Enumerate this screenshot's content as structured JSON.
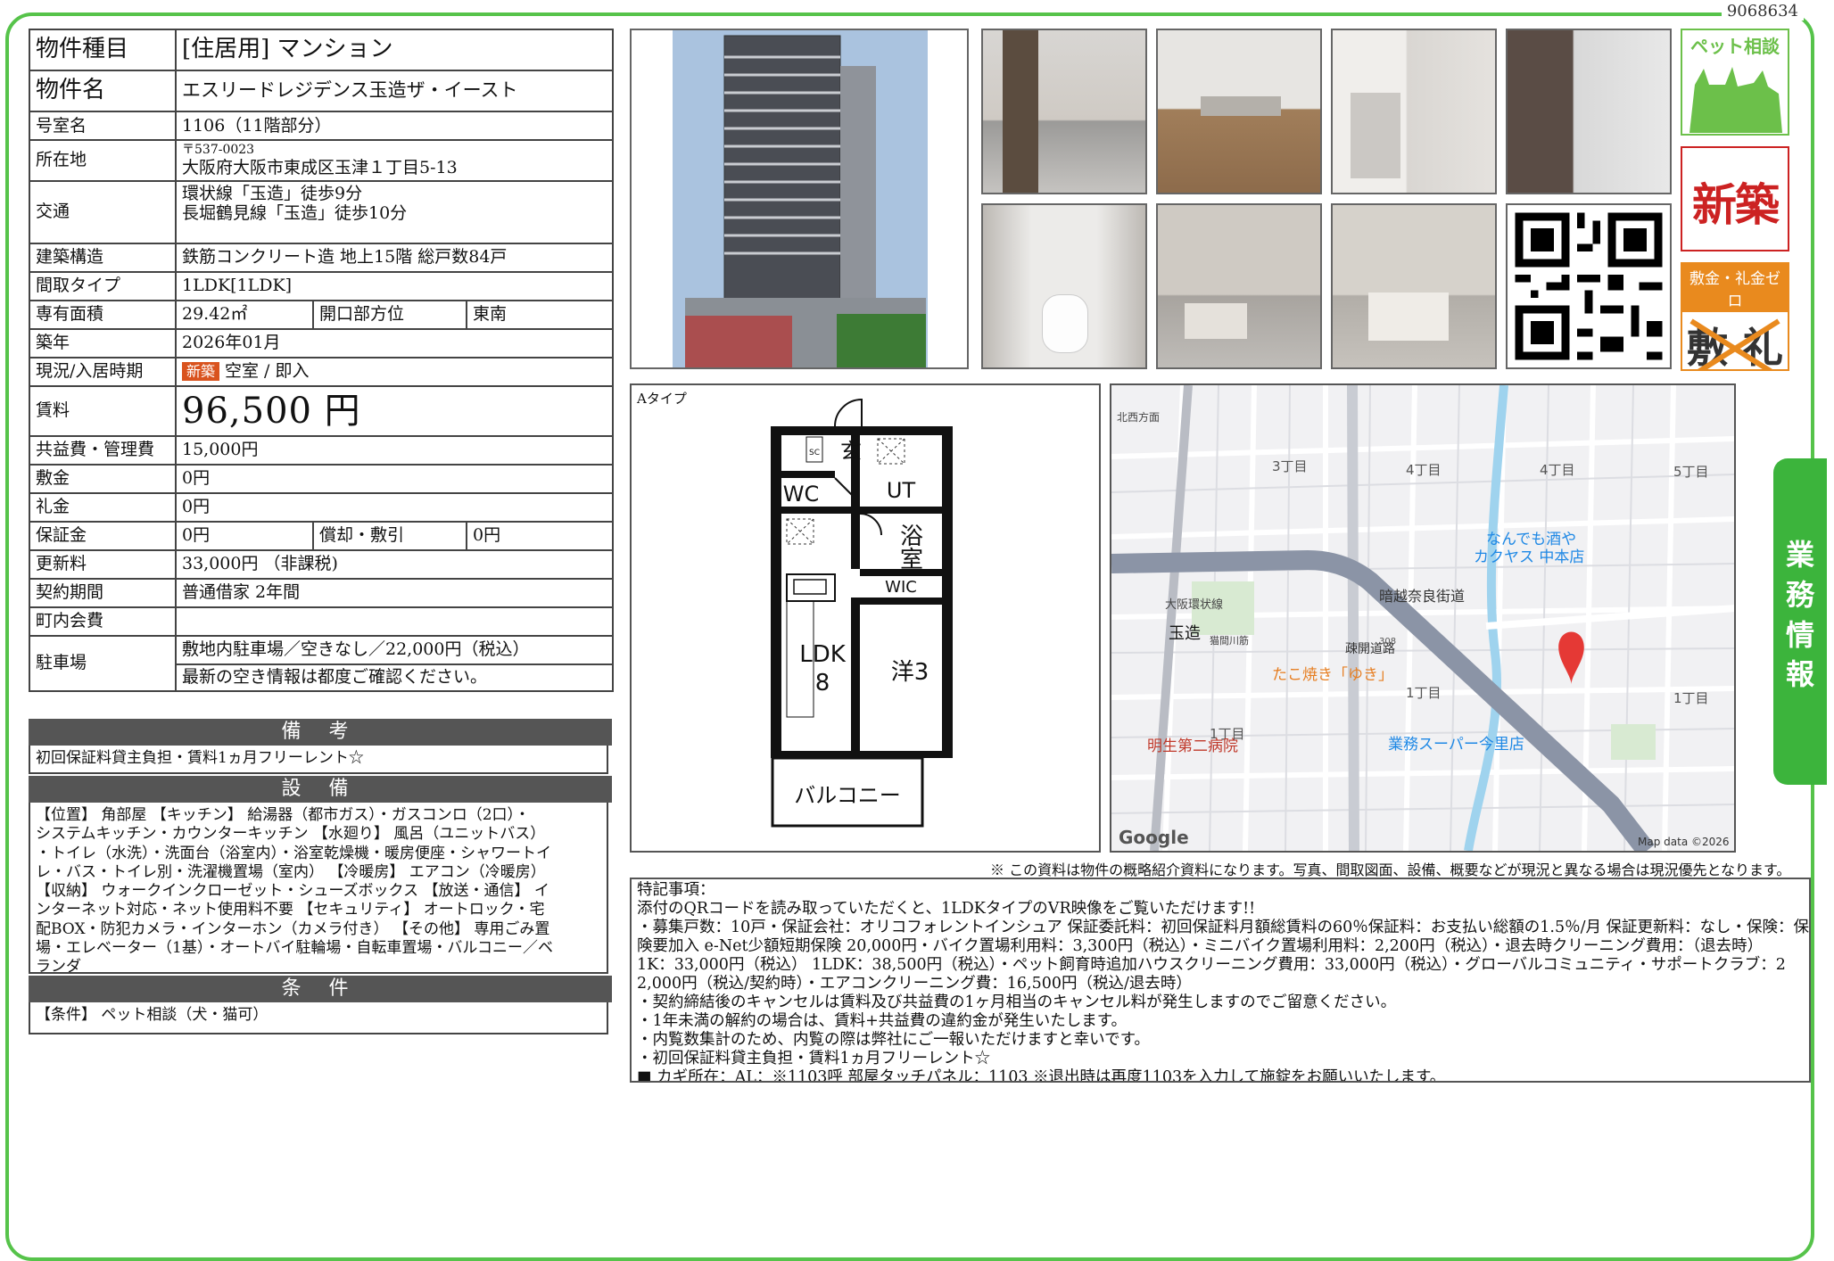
{
  "page_id": "9068634",
  "info": {
    "type_label": "物件種目",
    "type_value": "[住居用] マンション",
    "name_label": "物件名",
    "name_value": "エスリードレジデンス玉造ザ・イースト",
    "room_label": "号室名",
    "room_value": "1106（11階部分）",
    "address_label": "所在地",
    "postal": "〒537-0023",
    "address_value": "大阪府大阪市東成区玉津１丁目5-13",
    "transport_label": "交通",
    "transport_1": "環状線「玉造」徒歩9分",
    "transport_2": "長堀鶴見線「玉造」徒歩10分",
    "structure_label": "建築構造",
    "structure_value": "鉄筋コンクリート造 地上15階 総戸数84戸",
    "layout_label": "間取タイプ",
    "layout_value": "1LDK[1LDK]",
    "area_label": "専有面積",
    "area_value": "29.42㎡",
    "direction_label": "開口部方位",
    "direction_value": "東南",
    "built_label": "築年",
    "built_value": "2026年01月",
    "status_label": "現況/入居時期",
    "status_badge": "新築",
    "status_value": "空室 / 即入",
    "rent_label": "賃料",
    "rent_value": "96,500 円",
    "mgmt_label": "共益費・管理費",
    "mgmt_value": "15,000円",
    "deposit_label": "敷金",
    "deposit_value": "0円",
    "key_label": "礼金",
    "key_value": "0円",
    "guarantee_label": "保証金",
    "guarantee_value": "0円",
    "amort_label": "償却・敷引",
    "amort_value": "0円",
    "renew_label": "更新料",
    "renew_value": "33,000円 （非課税)",
    "contract_label": "契約期間",
    "contract_value": "普通借家 2年間",
    "town_label": "町内会費",
    "town_value": "",
    "parking_label": "駐車場",
    "parking_1": "敷地内駐車場／空きなし／22,000円（税込）",
    "parking_2": "最新の空き情報は都度ご確認ください。"
  },
  "remarks": {
    "title": "備 考",
    "text": "初回保証料貸主負担・賃料1ヵ月フリーレント☆"
  },
  "equipment": {
    "title": "設 備",
    "lines": [
      "【位置】 角部屋 【キッチン】 給湯器（都市ガス）・ガスコンロ（2口）・",
      "システムキッチン・カウンターキッチン 【水廻り】 風呂（ユニットバス）",
      "・トイレ（水洗）・洗面台（浴室内）・浴室乾燥機・暖房便座・シャワートイ",
      "レ・バス・トイレ別・洗濯機置場（室内） 【冷暖房】 エアコン（冷暖房）",
      "【収納】 ウォークインクローゼット・シューズボックス 【放送・通信】 イ",
      "ンターネット対応・ネット使用料不要 【セキュリティ】 オートロック・宅",
      "配BOX・防犯カメラ・インターホン（カメラ付き） 【その他】 専用ごみ置",
      "場・エレベーター（1基）・オートバイ駐輪場・自転車置場・バルコニー／ベ",
      "ランダ"
    ]
  },
  "conditions": {
    "title": "条 件",
    "text": "【条件】 ペット相談（犬・猫可）"
  },
  "badges": {
    "pet": "ペット相談",
    "new_build": "新築",
    "zero_top": "敷金・礼金ゼロ",
    "zero_mark": "敷 礼"
  },
  "floorplan": {
    "type_label": "Aタイプ",
    "rooms": {
      "entrance": "玄",
      "sc": "SC",
      "wc": "WC",
      "ut": "UT",
      "bath_1": "浴",
      "bath_2": "室",
      "wic": "WIC",
      "ldk_1": "LDK",
      "ldk_2": "8",
      "western": "洋3",
      "balcony": "バルコニー"
    }
  },
  "map": {
    "labels": {
      "chome3": "3丁目",
      "chome4a": "4丁目",
      "chome4b": "4丁目",
      "chome5": "5丁目",
      "chome1a": "1丁目",
      "chome1b": "1丁目",
      "chome1c": "1丁目",
      "kitamuki": "北西方面",
      "osaka_loop": "大阪環状線",
      "tamatsukuri": "玉造",
      "hakuba": "猫間川筋",
      "street": "疎開道路",
      "kuragoe": "暗越奈良街道",
      "route": "308",
      "nande_1": "なんでも酒や",
      "nande_2": "カクヤス 中本店",
      "takoyaki": "たこ焼き「ゆき」",
      "hospital": "明生第二病院",
      "super": "業務スーパー今里店",
      "google": "Google",
      "mapdata": "Map data ©2026"
    }
  },
  "notice": "※ この資料は物件の概略紹介資料になります。写真、間取図面、設備、概要などが現況と異なる場合は現況優先となります。",
  "special": {
    "lines": [
      "特記事項：",
      "添付のQRコードを読み取っていただくと、1LDKタイプのVR映像をご覧いただけます!!",
      "・募集戸数：10戸・保証会社：オリコフォレントインシュア 保証委託料：初回保証料月額総賃料の60％保証料：お支払い総額の1.5％/月 保証更新料：なし・保険：保",
      "険要加入 e-Net少額短期保険 20,000円・バイク置場利用料：3,300円（税込）・ミニバイク置場利用料：2,200円（税込）・退去時クリーニング費用：（退去時）",
      "1K：33,000円（税込） 1LDK：38,500円（税込）・ペット飼育時追加ハウスクリーニング費用：33,000円（税込）・グローバルコミュニティ・サポートクラブ：2",
      "2,000円（税込/契約時）・エアコンクリーニング費：16,500円（税込/退去時）",
      "・契約締結後のキャンセルは賃料及び共益費の1ヶ月相当のキャンセル料が発生しますのでご留意ください。",
      "・1年未満の解約の場合は、賃料+共益費の違約金が発生いたします。",
      "・内覧数集計のため、内覧の際は弊社にご一報いただけますと幸いです。",
      "・初回保証料貸主負担・賃料1ヵ月フリーレント☆",
      "■ カギ所在：AL：※1103呼 部屋タッチパネル：1103 ※退出時は再度1103を入力して施錠をお願いいたします。"
    ]
  },
  "side_tab": {
    "c1": "業",
    "c2": "務",
    "c3": "情",
    "c4": "報"
  },
  "colors": {
    "frame": "#56c34a",
    "header_bar": "#555555",
    "badge_new": "#d9531e",
    "pet_green": "#6cc04a",
    "new_red": "#cc2222",
    "zero_orange": "#e98a1e"
  }
}
